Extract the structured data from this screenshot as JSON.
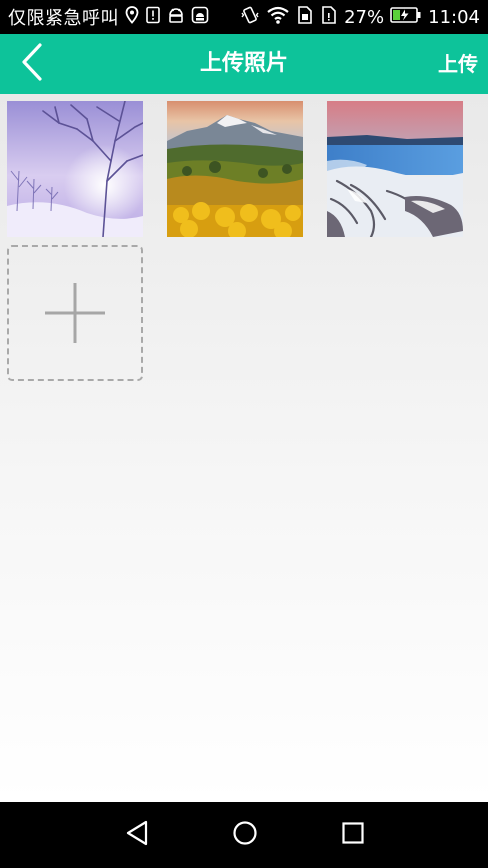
{
  "status_bar": {
    "carrier": "仅限紧急呼叫",
    "battery_percent": "27%",
    "time": "11:04",
    "icons": [
      "location-icon",
      "sim-alert-icon",
      "android-debug-icon",
      "android-notification-icon",
      "vibrate-icon",
      "wifi-icon",
      "sim-card-1-icon",
      "sim-card-2-icon",
      "battery-charging-icon"
    ]
  },
  "header": {
    "title": "上传照片",
    "upload_label": "上传",
    "back_icon": "back-chevron-icon",
    "background_color": "#0dc39a"
  },
  "gallery": {
    "photos": [
      {
        "subject": "winter-forest"
      },
      {
        "subject": "autumn-mountain"
      },
      {
        "subject": "snowy-lake"
      }
    ],
    "add_icon": "plus-icon"
  },
  "nav_bar": {
    "icons": [
      "nav-back-icon",
      "nav-home-icon",
      "nav-recents-icon"
    ]
  }
}
